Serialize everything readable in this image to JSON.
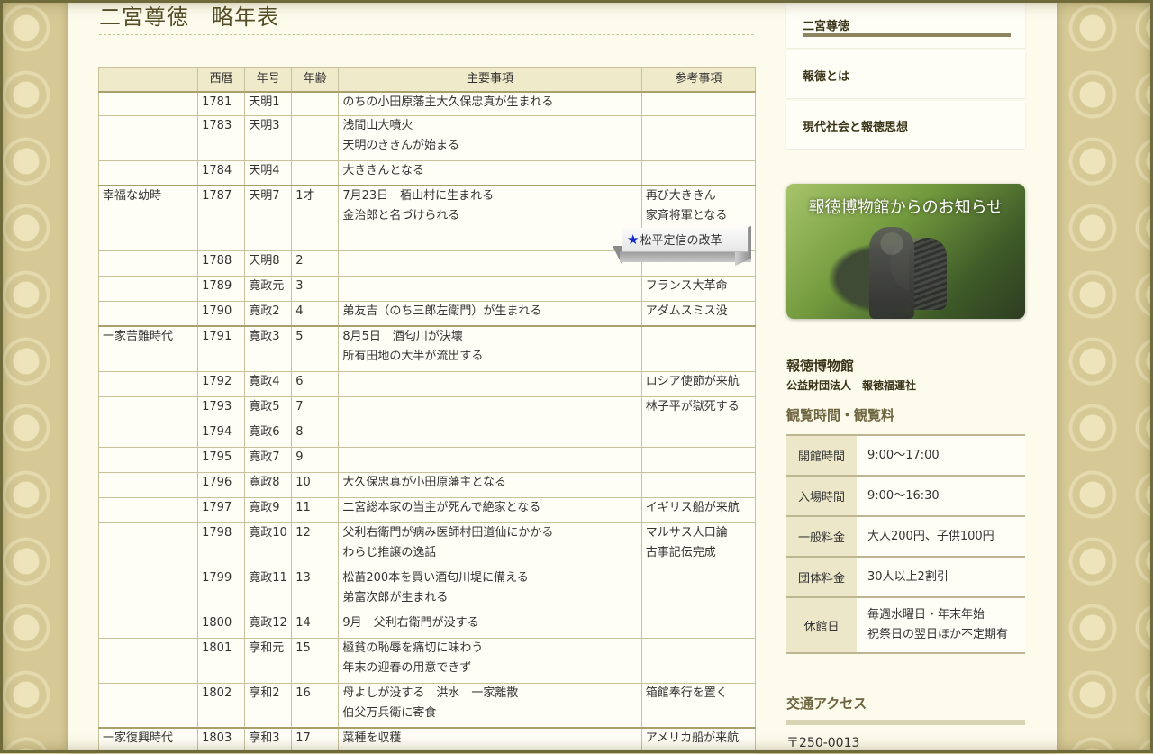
{
  "page": {
    "title": "二宮尊徳　略年表"
  },
  "table": {
    "headers": [
      "",
      "西暦",
      "年号",
      "年齢",
      "主要事項",
      "参考事項"
    ],
    "rows": [
      {
        "period": "",
        "year": "1781",
        "era": "天明1",
        "age": "",
        "main": [
          "のちの小田原藩主大久保忠真が生まれる"
        ],
        "ref": []
      },
      {
        "period": "",
        "year": "1783",
        "era": "天明3",
        "age": "",
        "main": [
          "浅間山大噴火",
          "天明のききんが始まる"
        ],
        "ref": []
      },
      {
        "period": "",
        "year": "1784",
        "era": "天明4",
        "age": "",
        "main": [
          "大ききんとなる"
        ],
        "ref": []
      },
      {
        "period": "幸福な幼時",
        "year": "1787",
        "era": "天明7",
        "age": "1才",
        "main": [
          "7月23日　栢山村に生まれる",
          "金治郎と名づけられる"
        ],
        "ref": [
          "再び大ききん",
          "家斉将軍となる"
        ]
      },
      {
        "period": "",
        "year": "1788",
        "era": "天明8",
        "age": "2",
        "main": [],
        "ref": []
      },
      {
        "period": "",
        "year": "1789",
        "era": "寛政元",
        "age": "3",
        "main": [],
        "ref": [
          "フランス大革命"
        ]
      },
      {
        "period": "",
        "year": "1790",
        "era": "寛政2",
        "age": "4",
        "main": [
          "弟友吉（のち三郎左衛門）が生まれる"
        ],
        "ref": [
          "アダムスミス没"
        ]
      },
      {
        "period": "一家苦難時代",
        "year": "1791",
        "era": "寛政3",
        "age": "5",
        "main": [
          "8月5日　酒匂川が決壊",
          "所有田地の大半が流出する"
        ],
        "ref": []
      },
      {
        "period": "",
        "year": "1792",
        "era": "寛政4",
        "age": "6",
        "main": [],
        "ref": [
          "ロシア使節が来航"
        ]
      },
      {
        "period": "",
        "year": "1793",
        "era": "寛政5",
        "age": "7",
        "main": [],
        "ref": [
          "林子平が獄死する"
        ]
      },
      {
        "period": "",
        "year": "1794",
        "era": "寛政6",
        "age": "8",
        "main": [],
        "ref": []
      },
      {
        "period": "",
        "year": "1795",
        "era": "寛政7",
        "age": "9",
        "main": [],
        "ref": []
      },
      {
        "period": "",
        "year": "1796",
        "era": "寛政8",
        "age": "10",
        "main": [
          "大久保忠真が小田原藩主となる"
        ],
        "ref": []
      },
      {
        "period": "",
        "year": "1797",
        "era": "寛政9",
        "age": "11",
        "main": [
          "二宮総本家の当主が死んで絶家となる"
        ],
        "ref": [
          "イギリス船が来航"
        ]
      },
      {
        "period": "",
        "year": "1798",
        "era": "寛政10",
        "age": "12",
        "main": [
          "父利右衛門が病み医師村田道仙にかかる",
          "わらじ推譲の逸話"
        ],
        "ref": [
          "マルサス人口論",
          "古事記伝完成"
        ]
      },
      {
        "period": "",
        "year": "1799",
        "era": "寛政11",
        "age": "13",
        "main": [
          "松苗200本を買い酒匂川堤に備える",
          "弟富次郎が生まれる"
        ],
        "ref": []
      },
      {
        "period": "",
        "year": "1800",
        "era": "寛政12",
        "age": "14",
        "main": [
          "9月　父利右衛門が没する"
        ],
        "ref": []
      },
      {
        "period": "",
        "year": "1801",
        "era": "享和元",
        "age": "15",
        "main": [
          "極貧の恥辱を痛切に味わう",
          "年末の迎春の用意できず"
        ],
        "ref": []
      },
      {
        "period": "",
        "year": "1802",
        "era": "享和2",
        "age": "16",
        "main": [
          "母よしが没する　洪水　一家離散",
          "伯父万兵衛に寄食"
        ],
        "ref": [
          "箱館奉行を置く"
        ]
      },
      {
        "period": "一家復興時代",
        "year": "1803",
        "era": "享和3",
        "age": "17",
        "main": [
          "菜種を収穫"
        ],
        "ref": [
          "アメリカ船が来航"
        ]
      }
    ],
    "sticker": "松平定信の改革"
  },
  "sidebar": {
    "nav": [
      "二宮尊徳",
      "報徳とは",
      "現代社会と報徳思想"
    ],
    "notice_banner": "報徳博物館からのお知らせ",
    "museum_name": "報徳博物館",
    "museum_org": "公益財団法人　報徳福運社",
    "hours_title": "観覧時間・観覧料",
    "info": [
      {
        "k": "開館時間",
        "v": [
          "9:00～17:00"
        ]
      },
      {
        "k": "入場時間",
        "v": [
          "9:00～16:30"
        ]
      },
      {
        "k": "一般料金",
        "v": [
          "大人200円、子供100円"
        ]
      },
      {
        "k": "団体料金",
        "v": [
          "30人以上2割引"
        ]
      },
      {
        "k": "休館日",
        "v": [
          "毎週水曜日・年末年始",
          "祝祭日の翌日ほか不定期有"
        ]
      }
    ],
    "access_title": "交通アクセス",
    "zip": "〒250-0013"
  },
  "colors": {
    "page_bg": "#fdfbec",
    "header_bg": "#efeac9",
    "border": "#c9c19a",
    "accent": "#8d8560",
    "star": "#1328c8"
  }
}
